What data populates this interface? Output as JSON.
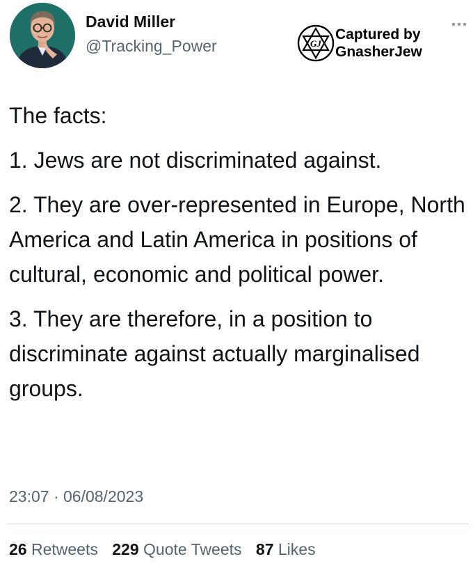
{
  "author": {
    "name": "David Miller",
    "handle": "@Tracking_Power",
    "avatar_icon": "person-avatar"
  },
  "watermark": {
    "line1": "Captured by",
    "line2": "GnasherJew",
    "logo_text": "GJ",
    "logo_icon": "star-of-david-logo"
  },
  "more_icon": "more-horizontal-icon",
  "tweet": {
    "paragraphs": [
      "The facts:",
      "1. Jews are not discriminated against.",
      "2. They are over-represented in Europe, North America and Latin America in positions of cultural, economic and political power.",
      "3. They are therefore, in a position to discriminate against actually marginalised groups."
    ],
    "timestamp": "23:07 · 06/08/2023"
  },
  "stats": {
    "retweets_count": "26",
    "retweets_label": "Retweets",
    "quotes_count": "229",
    "quotes_label": "Quote Tweets",
    "likes_count": "87",
    "likes_label": "Likes"
  },
  "colors": {
    "text_primary": "#0f1419",
    "text_secondary": "#536471",
    "divider": "#cfd9de",
    "avatar_bg": "#1e6f67"
  }
}
